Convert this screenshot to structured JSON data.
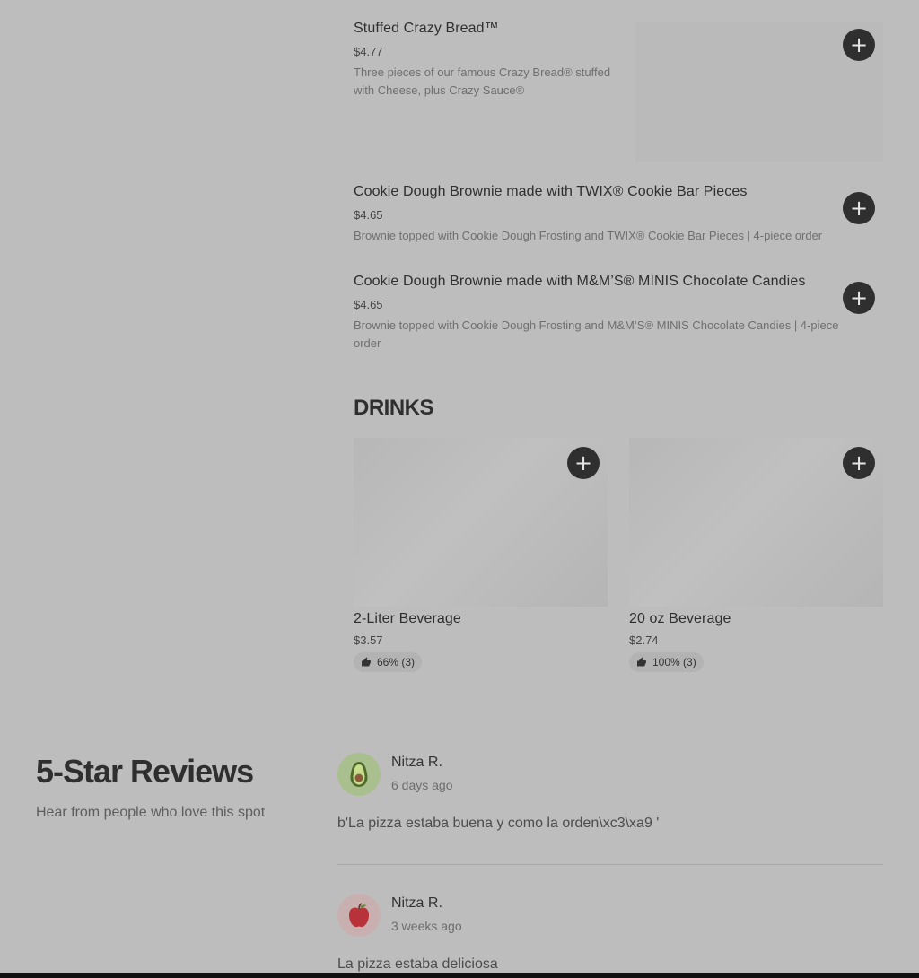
{
  "menu_items": [
    {
      "title": "Stuffed Crazy Bread™",
      "price": "$4.77",
      "description": "Three pieces of our famous Crazy Bread® stuffed with Cheese, plus Crazy Sauce®"
    },
    {
      "title": "Cookie Dough Brownie made with TWIX® Cookie Bar Pieces",
      "price": "$4.65",
      "description": "Brownie topped with Cookie Dough Frosting and TWIX® Cookie Bar Pieces | 4-piece order"
    },
    {
      "title": "Cookie Dough Brownie made with M&M’S® MINIS Chocolate Candies",
      "price": "$4.65",
      "description": "Brownie topped with Cookie Dough Frosting and M&M’S® MINIS Chocolate Candies | 4-piece order"
    }
  ],
  "add_symbol": "+",
  "drinks": {
    "title": "DRINKS",
    "items": [
      {
        "title": "2-Liter Beverage",
        "price": "$3.57",
        "rating": "66% (3)"
      },
      {
        "title": "20 oz Beverage",
        "price": "$2.74",
        "rating": "100% (3)"
      }
    ]
  },
  "reviews": {
    "title": "5-Star Reviews",
    "subtitle": "Hear from people who love this spot",
    "items": [
      {
        "name": "Nitza R.",
        "date": "6 days ago",
        "text": "b'La pizza estaba buena y como la orden\\xc3\\xa9 '",
        "avatar_icon": "avocado-icon",
        "avatar_color": "#a9bf8e"
      },
      {
        "name": "Nitza R.",
        "date": "3 weeks ago",
        "text": "La pizza estaba deliciosa",
        "avatar_icon": "apple-icon",
        "avatar_color": "#c9b0b0"
      }
    ]
  }
}
